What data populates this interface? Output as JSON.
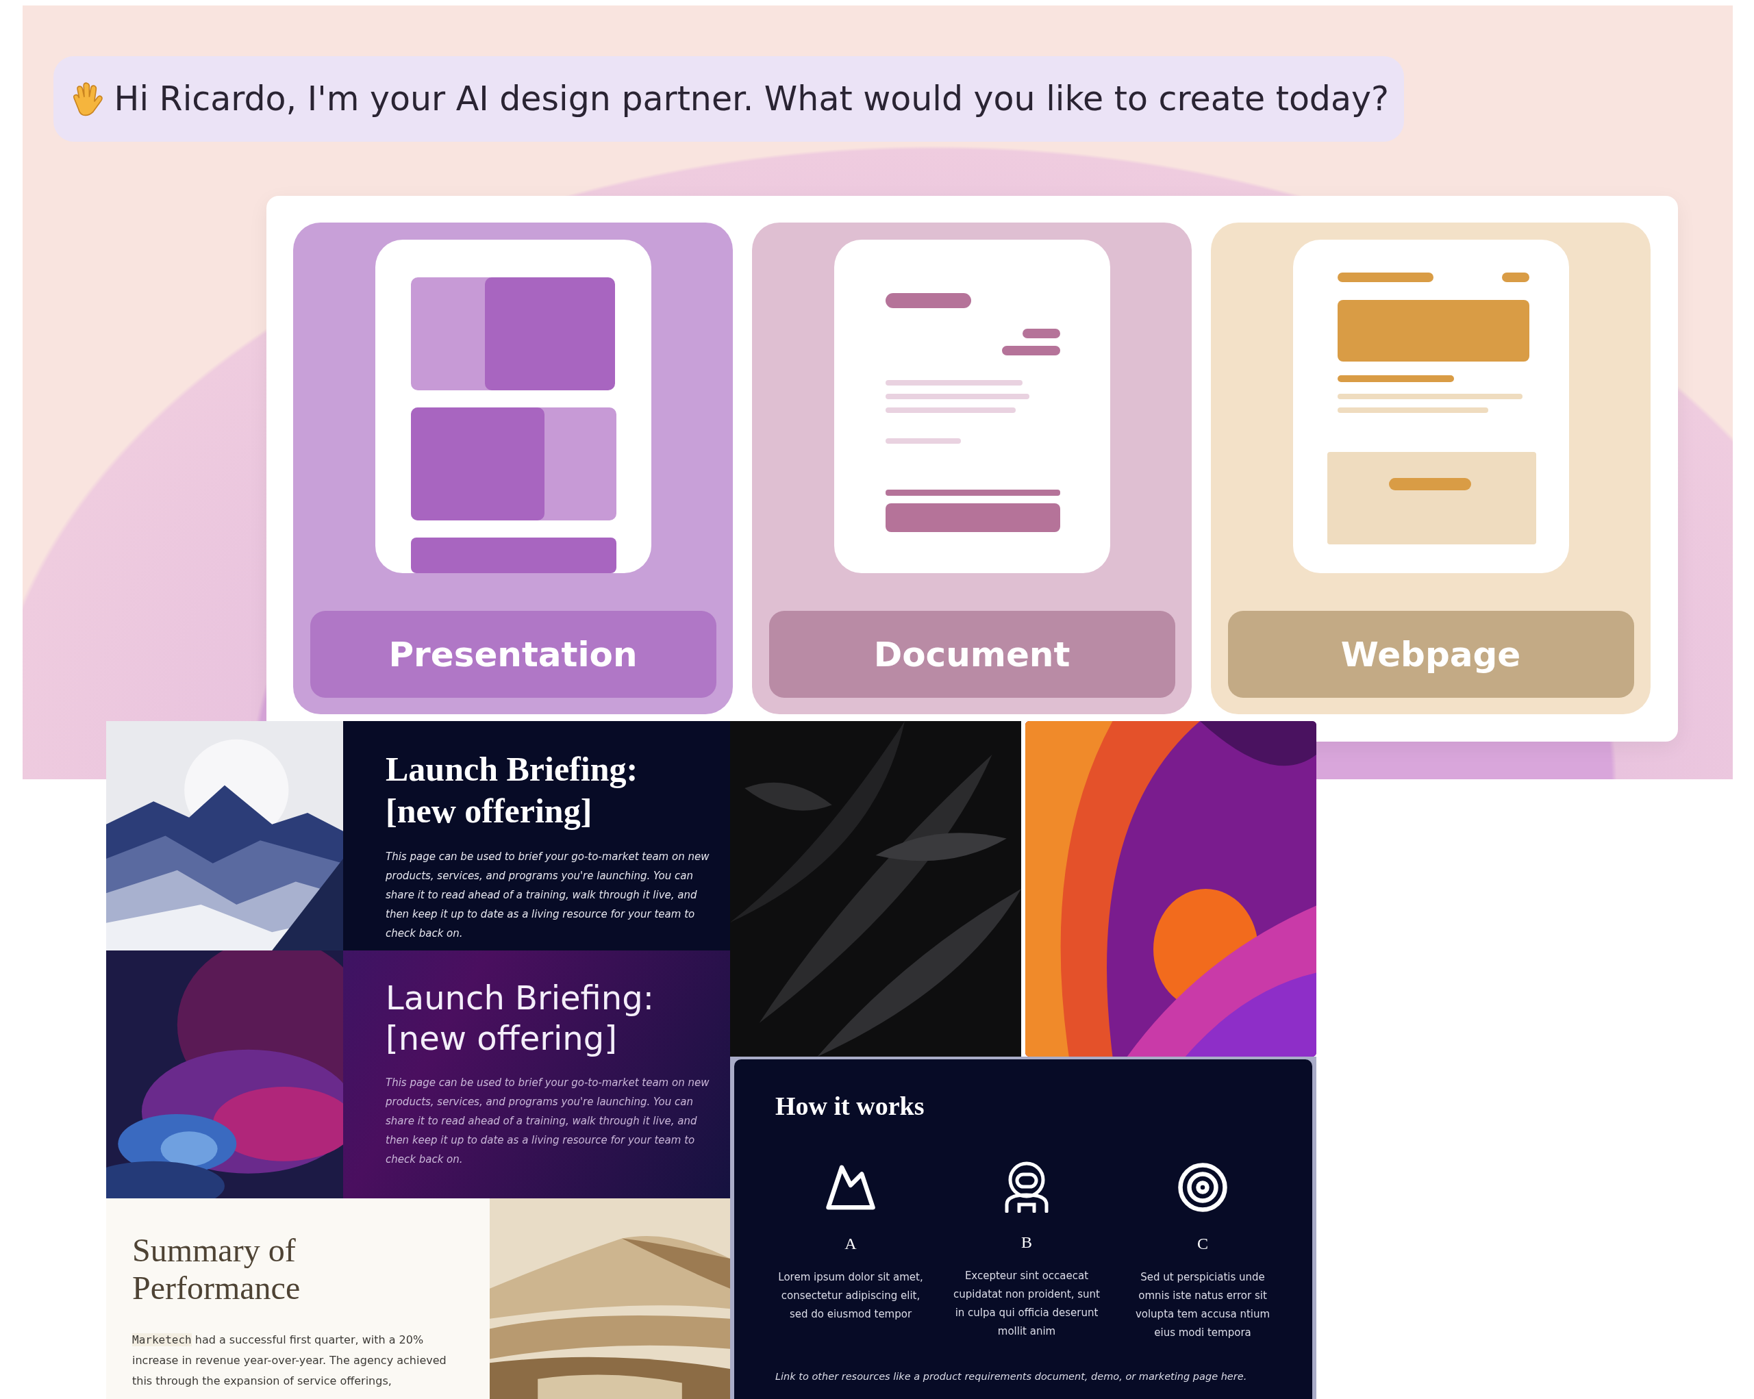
{
  "greeting": {
    "text": "Hi Ricardo, I'm your AI design partner. What would you like to create today?"
  },
  "create_options": [
    {
      "kind": "presentation",
      "label": "Presentation"
    },
    {
      "kind": "document",
      "label": "Document"
    },
    {
      "kind": "webpage",
      "label": "Webpage"
    }
  ],
  "template_gallery": {
    "briefings": [
      {
        "kind": "serif",
        "title": "Launch Briefing:\n[new offering]",
        "body": "This page can be used to brief your go-to-market team on new products, services, and programs you're launching. You can share it to read ahead of a training, walk through it live, and then keep it up to date as a living resource for your team to check back on."
      },
      {
        "kind": "sans",
        "title": "Launch Briefing:\n[new offering]",
        "body": "This page can be used to brief your go-to-market team on new products, services, and programs you're launching. You can share it to read ahead of a training, walk through it live, and then keep it up to date as a living resource for your team to check back on."
      }
    ],
    "summary": {
      "title": "Summary of\nPerformance",
      "code_term": "Marketech",
      "body": " had a successful first quarter, with a 20% increase in revenue year-over-year. The agency achieved this through the expansion of service offerings,"
    },
    "how_it_works": {
      "title": "How it works",
      "steps": [
        {
          "kind": "mountain",
          "letter": "A",
          "text": "Lorem ipsum dolor sit amet, consectetur adipiscing elit, sed do eiusmod tempor"
        },
        {
          "kind": "astronaut",
          "letter": "B",
          "text": "Excepteur sint occaecat cupidatat non proident, sunt in culpa qui officia deserunt mollit anim"
        },
        {
          "kind": "target",
          "letter": "C",
          "text": "Sed ut perspiciatis unde omnis iste natus error sit volupta tem accusa ntium eius modi tempora"
        }
      ],
      "footer": "Link to other resources like a product requirements document, demo, or marketing page here."
    }
  }
}
